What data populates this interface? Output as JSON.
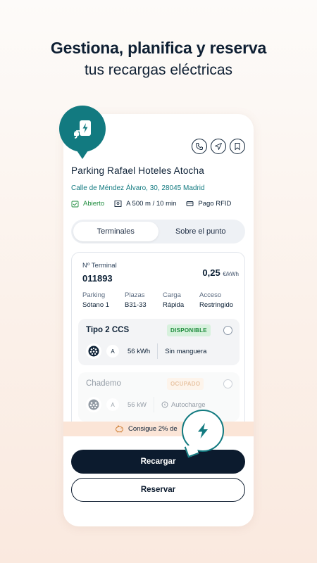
{
  "headline": {
    "title": "Gestiona, planifica y reserva",
    "subtitle": "tus recargas eléctricas"
  },
  "colors": {
    "brand_teal": "#127a80",
    "navy": "#0c1b2e",
    "available_green": "#1b8a3a",
    "busy_orange": "#d0833b",
    "promo_bg": "#fbe5d7"
  },
  "pin": {
    "icon": "charger-plug-icon"
  },
  "actions": {
    "call_icon": "phone-icon",
    "navigate_icon": "navigation-arrow-icon",
    "save_icon": "bookmark-icon"
  },
  "station": {
    "name": "Parking Rafael Hoteles Atocha",
    "address": "Calle de Méndez Álvaro, 30, 28045 Madrid",
    "status": "Abierto",
    "distance": "A 500 m / 10 min",
    "payment": "Pago RFID"
  },
  "tabs": [
    {
      "label": "Terminales",
      "active": true
    },
    {
      "label": "Sobre el punto",
      "active": false
    }
  ],
  "terminal": {
    "number_label": "Nº Terminal",
    "number": "011893",
    "price": "0,25",
    "price_unit": "€/kWh",
    "fields": [
      {
        "key": "Parking",
        "value": "Sótano 1"
      },
      {
        "key": "Plazas",
        "value": "B31-33"
      },
      {
        "key": "Carga",
        "value": "Rápida"
      },
      {
        "key": "Acceso",
        "value": "Restringido"
      }
    ]
  },
  "connectors": [
    {
      "type": "Tipo 2 CCS",
      "status": "DISPONIBLE",
      "current": "A",
      "power": "56 kWh",
      "extra": "Sin manguera"
    },
    {
      "type": "Chademo",
      "status": "OCUPADO",
      "current": "A",
      "power": "56 kW",
      "extra": "Autocharge"
    }
  ],
  "promo": {
    "text": "Consigue 2% de"
  },
  "buttons": {
    "primary": "Recargar",
    "secondary": "Reservar"
  }
}
